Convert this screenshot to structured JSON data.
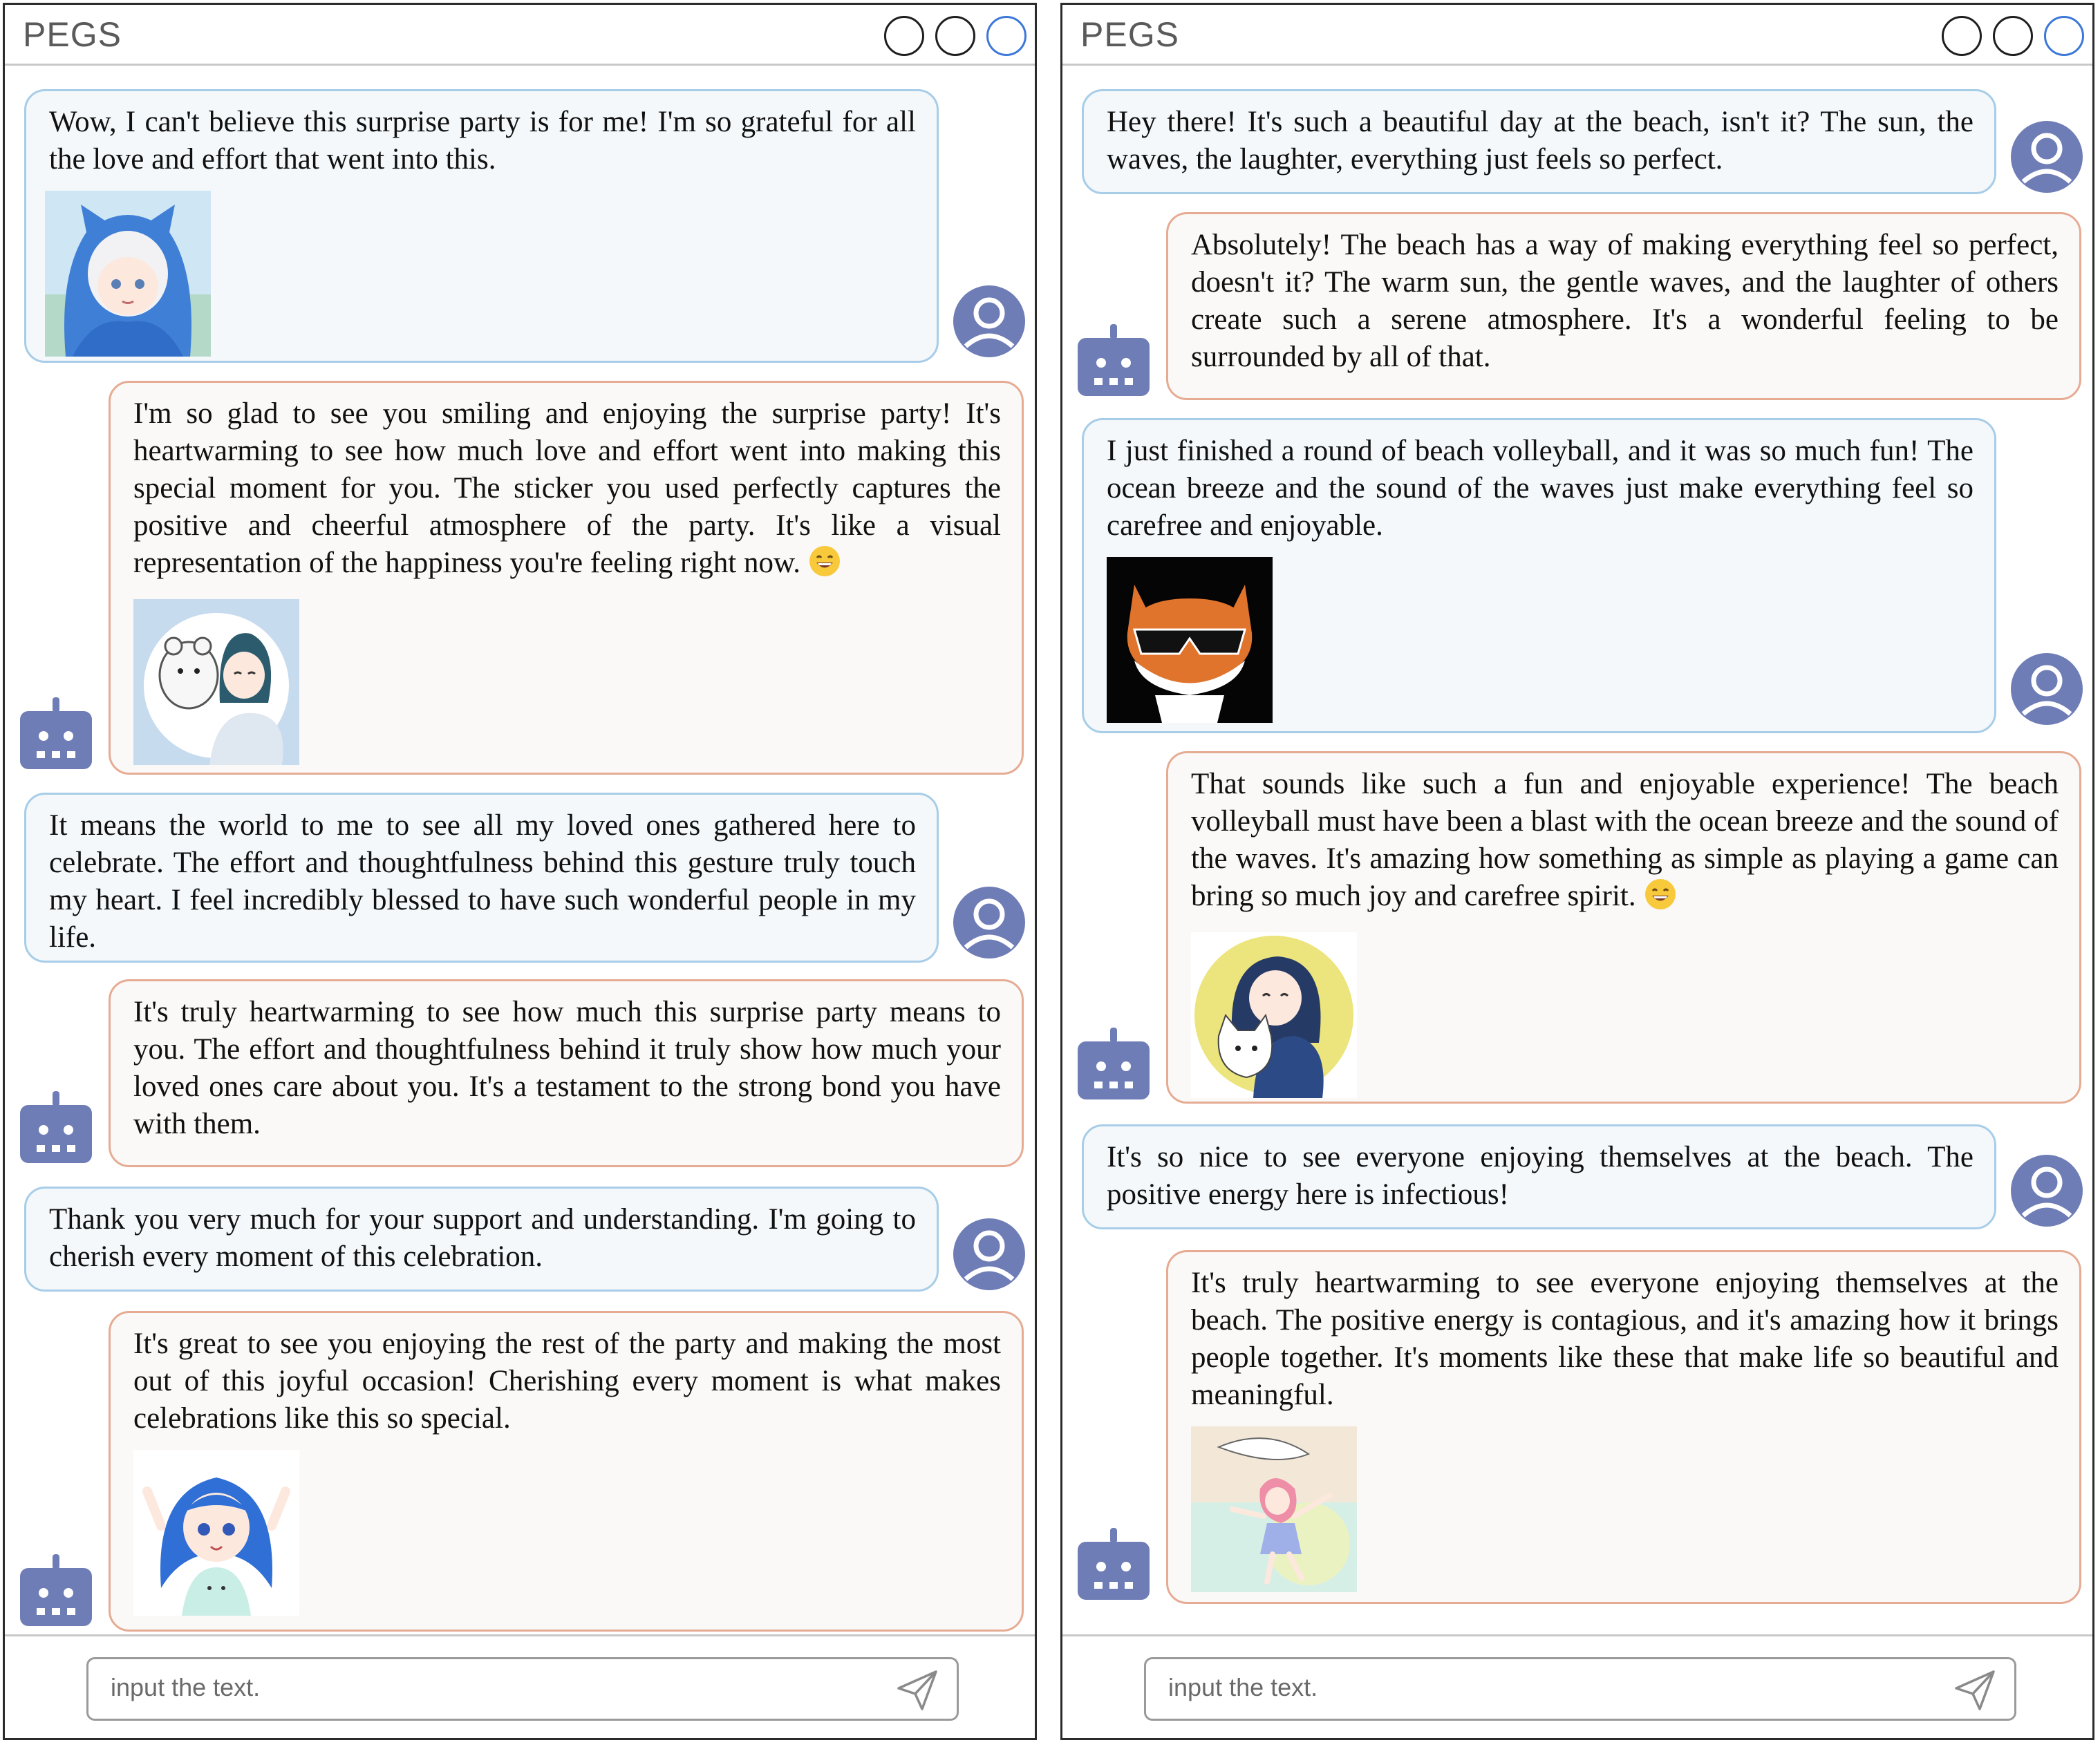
{
  "windows": [
    {
      "app_title": "PEGS",
      "input_placeholder": "input the text.",
      "messages": [
        {
          "role": "user",
          "text": "Wow, I can't believe this surprise party is for me! I'm so grateful for all the love and effort that went into this.",
          "sticker": "anime-girl-blue-hood-sticker"
        },
        {
          "role": "bot",
          "text": "I'm so glad to see you smiling and enjoying the surprise party! It's heartwarming to see how much love and effort went into making this special moment for you. The sticker you used perfectly captures the positive and cheerful atmosphere of the party. It's like a visual representation of the happiness you're feeling right now.",
          "emoji": "😄",
          "sticker": "girl-hugging-plush-sticker"
        },
        {
          "role": "user",
          "text": "It means the world to me to see all my loved ones gathered here to celebrate. The effort and thoughtfulness behind this gesture truly touch my heart. I feel incredibly blessed to have such wonderful people in my life."
        },
        {
          "role": "bot",
          "text": "It's truly heartwarming to see how much this surprise party means to you. The effort and thoughtfulness behind it truly show how much your loved ones care about you. It's a testament to the strong bond you have with them."
        },
        {
          "role": "user",
          "text": "Thank you very much for your support and understanding.  I'm going to cherish every moment of this celebration."
        },
        {
          "role": "bot",
          "text": "It's great to see you enjoying the rest of the party and making the most out of this joyful occasion! Cherishing every moment is what makes celebrations like this so special.",
          "sticker": "blue-hair-girl-cheering-sticker"
        }
      ]
    },
    {
      "app_title": "PEGS",
      "input_placeholder": "input the text.",
      "messages": [
        {
          "role": "user",
          "text": "Hey there! It's such a beautiful day at the beach, isn't it? The sun, the waves, the laughter, everything just feels so perfect."
        },
        {
          "role": "bot",
          "text": "Absolutely! The beach has a way of making everything feel so perfect, doesn't it? The warm sun, the gentle waves, and the laughter of others create such a serene atmosphere. It's a wonderful feeling to be surrounded by all of that."
        },
        {
          "role": "user",
          "text": "I just finished a round of beach volleyball, and it was so much fun! The ocean breeze and the sound of the waves just make everything feel so carefree and enjoyable.",
          "sticker": "fox-sunglasses-sticker"
        },
        {
          "role": "bot",
          "text": "That sounds like such a fun and enjoyable experience! The beach volleyball must have been a blast with the ocean breeze and the sound of the waves. It's amazing how something as simple as playing a game can bring so much joy and carefree spirit.",
          "emoji": "😄",
          "sticker": "girl-with-cat-yellow-circle-sticker"
        },
        {
          "role": "user",
          "text": "It's so nice to see everyone enjoying themselves at the beach. The positive energy here is infectious!"
        },
        {
          "role": "bot",
          "text": "It's truly heartwarming to see everyone enjoying themselves at the beach. The positive energy is contagious, and it's amazing how it brings people together. It's moments like these that make life so beautiful and meaningful.",
          "sticker": "pink-hair-girl-floating-sticker"
        }
      ]
    }
  ],
  "colors": {
    "user_bubble_border": "#a7cde8",
    "bot_bubble_border": "#e6ab93",
    "avatar": "#6f7db6",
    "accent_control": "#3c78d8"
  }
}
